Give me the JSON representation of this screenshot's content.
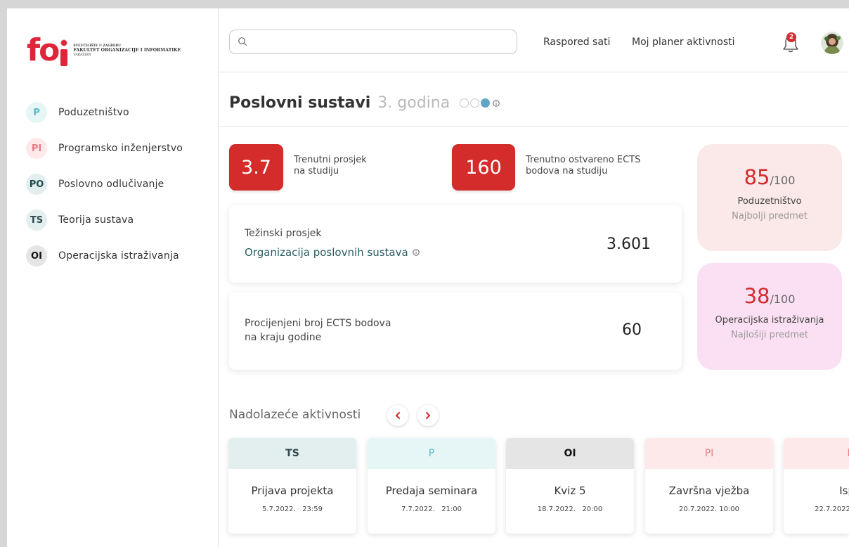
{
  "logo": {
    "mark": "fo",
    "line1": "SVEUČILIŠTE U ZAGREBU",
    "line2": "FAKULTET ORGANIZACIJE I INFORMATIKE",
    "line3": "VARAŽDIN"
  },
  "sidebar": {
    "items": [
      {
        "badge": "P",
        "label": "Poduzetništvo"
      },
      {
        "badge": "PI",
        "label": "Programsko inženjerstvo"
      },
      {
        "badge": "PO",
        "label": "Poslovno odlučivanje"
      },
      {
        "badge": "TS",
        "label": "Teorija sustava"
      },
      {
        "badge": "OI",
        "label": "Operacijska istraživanja"
      }
    ]
  },
  "header": {
    "search_placeholder": "",
    "links": [
      "Raspored sati",
      "Moj planer aktivnosti"
    ],
    "notification_count": "2"
  },
  "page": {
    "title": "Poslovni sustavi",
    "year": "3. godina",
    "year_dots": 3,
    "active_year_dot": 3
  },
  "stats": [
    {
      "value": "3.7",
      "label": "Trenutni prosjek\nna studiju"
    },
    {
      "value": "160",
      "label": "Trenutno ostvareno ECTS\nbodova na studiju"
    }
  ],
  "weighted_avg": {
    "label": "Težinski prosjek",
    "program": "Organizacija poslovnih sustava",
    "value": "3.601"
  },
  "ects_estimate": {
    "label_line1": "Procijenjeni broj ECTS bodova",
    "label_line2": "na kraju godine",
    "value": "60"
  },
  "grades": [
    {
      "score": "85",
      "max": "/100",
      "subject": "Poduzetništvo",
      "note": "Najbolji predmet"
    },
    {
      "score": "38",
      "max": "/100",
      "subject": "Operacijska istraživanja",
      "note": "Najlošiji predmet"
    }
  ],
  "activities": {
    "title": "Nadolazeće aktivnosti",
    "items": [
      {
        "tag": "TS",
        "name": "Prijava projekta",
        "date": "5.7.2022.   23:59"
      },
      {
        "tag": "P",
        "name": "Predaja seminara",
        "date": "7.7.2022.   21:00"
      },
      {
        "tag": "OI",
        "name": "Kviz 5",
        "date": "18.7.2022.   20:00"
      },
      {
        "tag": "PI",
        "name": "Završna vježba",
        "date": "20.7.2022. 10:00"
      },
      {
        "tag": "P",
        "name": "Isp",
        "date": "22.7.2022"
      }
    ]
  },
  "colors": {
    "accent_red": "#d42b2b",
    "brand_red": "#e0253a",
    "program_teal": "#2a5d62"
  }
}
